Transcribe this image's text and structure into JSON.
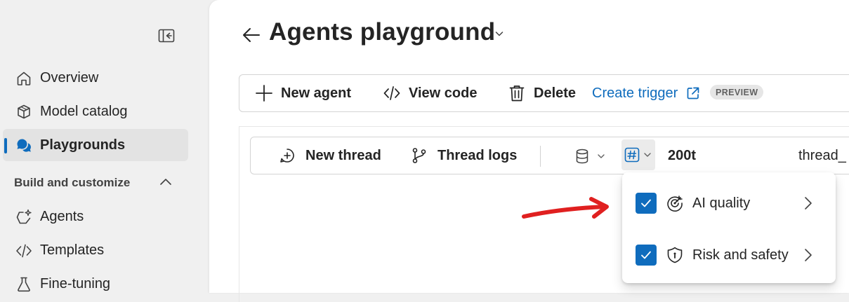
{
  "sidebar": {
    "nav_top": [
      {
        "label": "Overview",
        "icon": "home-icon"
      },
      {
        "label": "Model catalog",
        "icon": "cube-icon"
      },
      {
        "label": "Playgrounds",
        "icon": "chat-bubbles-icon",
        "selected": true
      }
    ],
    "section_title": "Build and customize",
    "nav_section": [
      {
        "label": "Agents",
        "icon": "agent-sparkle-icon"
      },
      {
        "label": "Templates",
        "icon": "code-icon"
      },
      {
        "label": "Fine-tuning",
        "icon": "flask-icon"
      }
    ]
  },
  "header": {
    "title": "Agents playground"
  },
  "toolbar": {
    "new_agent": "New agent",
    "view_code": "View code",
    "delete": "Delete",
    "create_trigger": "Create trigger",
    "preview_badge": "PREVIEW"
  },
  "thread_bar": {
    "new_thread": "New thread",
    "thread_logs": "Thread logs",
    "token_count": "200t",
    "thread_id": "thread_"
  },
  "metrics_menu": {
    "items": [
      {
        "label": "AI quality",
        "checked": true,
        "icon": "target-icon"
      },
      {
        "label": "Risk and safety",
        "checked": true,
        "icon": "shield-icon"
      }
    ]
  },
  "colors": {
    "accent": "#0f6cbd",
    "annotation": "#e02020",
    "sidebar_bg": "#f0f0f0"
  }
}
